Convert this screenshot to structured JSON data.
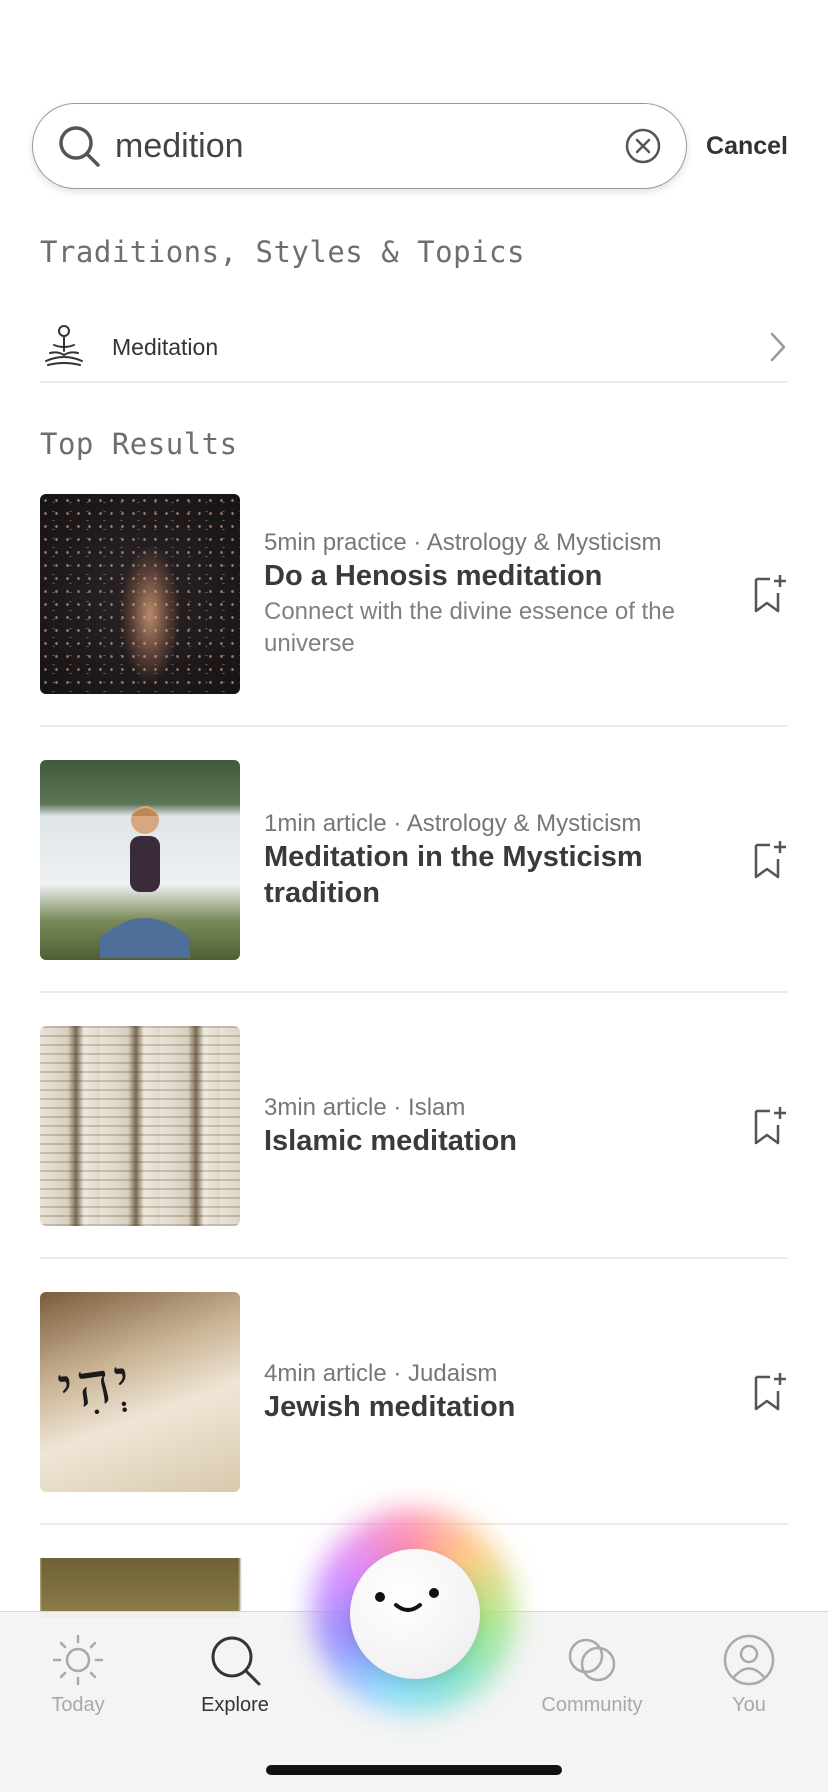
{
  "search": {
    "value": "medition",
    "cancel_label": "Cancel"
  },
  "sections": {
    "traditions_title": "Traditions, Styles & Topics",
    "top_results_title": "Top Results"
  },
  "topics": [
    {
      "label": "Meditation"
    }
  ],
  "results": [
    {
      "meta": "5min practice · Astrology & Mysticism",
      "title": "Do a Henosis meditation",
      "desc": "Connect with the divine essence of the universe"
    },
    {
      "meta": "1min article · Astrology & Mysticism",
      "title": "Meditation in the Mysticism tradition",
      "desc": ""
    },
    {
      "meta": "3min article · Islam",
      "title": "Islamic meditation",
      "desc": ""
    },
    {
      "meta": "4min article · Judaism",
      "title": "Jewish meditation",
      "desc": ""
    }
  ],
  "thumb_text": {
    "hebrew": "יְהִי"
  },
  "tabs": [
    {
      "label": "Today",
      "icon": "sun-icon"
    },
    {
      "label": "Explore",
      "icon": "search-icon"
    },
    {
      "label": "Community",
      "icon": "community-icon"
    },
    {
      "label": "You",
      "icon": "profile-icon"
    }
  ],
  "colors": {
    "text": "#333333",
    "muted": "#777777",
    "divider": "#ececec",
    "tab_inactive": "#a9a9a9"
  }
}
